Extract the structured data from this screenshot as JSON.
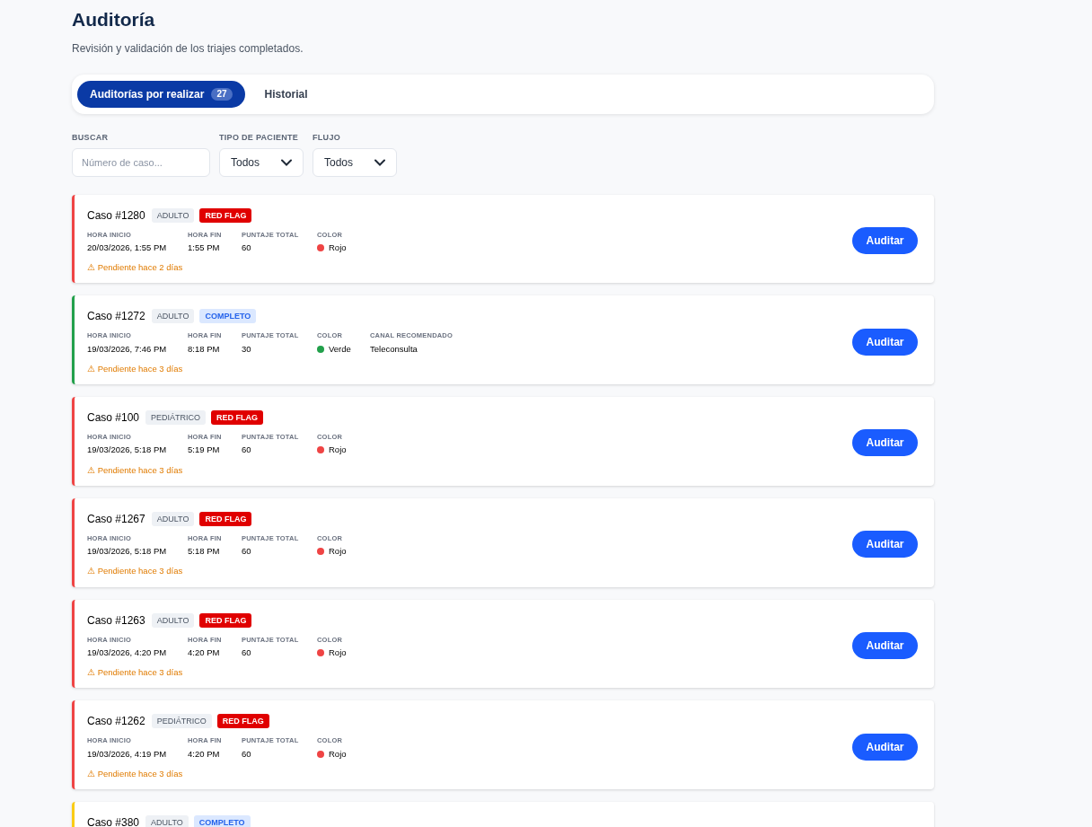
{
  "header": {
    "title": "Auditoría",
    "subtitle": "Revisión y validación de los triajes completados."
  },
  "tabs": [
    {
      "label": "Auditorías por realizar",
      "count": "27",
      "selected": true
    },
    {
      "label": "Historial",
      "selected": false
    }
  ],
  "filters": [
    {
      "kind": "search",
      "label": "BUSCAR",
      "placeholder": "Número de caso..."
    },
    {
      "kind": "select",
      "label": "TIPO DE PACIENTE",
      "value": "Todos"
    },
    {
      "kind": "select",
      "label": "FLUJO",
      "value": "Todos"
    }
  ],
  "cases": [
    {
      "title": "Caso #1280",
      "patient": "ADULTO",
      "status": {
        "kind": "red_flag",
        "label": "RED FLAG"
      },
      "color": "#ef4444",
      "fields": [
        {
          "label": "HORA INICIO",
          "value": "20/03/2026, 1:55 PM"
        },
        {
          "label": "HORA FIN",
          "value": "1:55 PM"
        },
        {
          "label": "PUNTAJE TOTAL",
          "value": "60"
        },
        {
          "kind": "color",
          "label": "COLOR",
          "value": "Rojo",
          "color": "#ef4444"
        }
      ],
      "pending": "⚠ Pendiente hace 2 días",
      "action": "Auditar"
    },
    {
      "title": "Caso #1272",
      "patient": "ADULTO",
      "status": {
        "kind": "complete",
        "label": "COMPLETO"
      },
      "color": "#22a04b",
      "fields": [
        {
          "label": "HORA INICIO",
          "value": "19/03/2026, 7:46 PM"
        },
        {
          "label": "HORA FIN",
          "value": "8:18 PM"
        },
        {
          "label": "PUNTAJE TOTAL",
          "value": "30"
        },
        {
          "kind": "color",
          "label": "COLOR",
          "value": "Verde",
          "color": "#22a04b"
        },
        {
          "label": "CANAL RECOMENDADO",
          "value": "Teleconsulta"
        }
      ],
      "pending": "⚠ Pendiente hace 3 días",
      "action": "Auditar"
    },
    {
      "title": "Caso #100",
      "patient": "PEDIÁTRICO",
      "status": {
        "kind": "red_flag",
        "label": "RED FLAG"
      },
      "color": "#ef4444",
      "fields": [
        {
          "label": "HORA INICIO",
          "value": "19/03/2026, 5:18 PM"
        },
        {
          "label": "HORA FIN",
          "value": "5:19 PM"
        },
        {
          "label": "PUNTAJE TOTAL",
          "value": "60"
        },
        {
          "kind": "color",
          "label": "COLOR",
          "value": "Rojo",
          "color": "#ef4444"
        }
      ],
      "pending": "⚠ Pendiente hace 3 días",
      "action": "Auditar"
    },
    {
      "title": "Caso #1267",
      "patient": "ADULTO",
      "status": {
        "kind": "red_flag",
        "label": "RED FLAG"
      },
      "color": "#ef4444",
      "fields": [
        {
          "label": "HORA INICIO",
          "value": "19/03/2026, 5:18 PM"
        },
        {
          "label": "HORA FIN",
          "value": "5:18 PM"
        },
        {
          "label": "PUNTAJE TOTAL",
          "value": "60"
        },
        {
          "kind": "color",
          "label": "COLOR",
          "value": "Rojo",
          "color": "#ef4444"
        }
      ],
      "pending": "⚠ Pendiente hace 3 días",
      "action": "Auditar"
    },
    {
      "title": "Caso #1263",
      "patient": "ADULTO",
      "status": {
        "kind": "red_flag",
        "label": "RED FLAG"
      },
      "color": "#ef4444",
      "fields": [
        {
          "label": "HORA INICIO",
          "value": "19/03/2026, 4:20 PM"
        },
        {
          "label": "HORA FIN",
          "value": "4:20 PM"
        },
        {
          "label": "PUNTAJE TOTAL",
          "value": "60"
        },
        {
          "kind": "color",
          "label": "COLOR",
          "value": "Rojo",
          "color": "#ef4444"
        }
      ],
      "pending": "⚠ Pendiente hace 3 días",
      "action": "Auditar"
    },
    {
      "title": "Caso #1262",
      "patient": "PEDIÁTRICO",
      "status": {
        "kind": "red_flag",
        "label": "RED FLAG"
      },
      "color": "#ef4444",
      "fields": [
        {
          "label": "HORA INICIO",
          "value": "19/03/2026, 4:19 PM"
        },
        {
          "label": "HORA FIN",
          "value": "4:20 PM"
        },
        {
          "label": "PUNTAJE TOTAL",
          "value": "60"
        },
        {
          "kind": "color",
          "label": "COLOR",
          "value": "Rojo",
          "color": "#ef4444"
        }
      ],
      "pending": "⚠ Pendiente hace 3 días",
      "action": "Auditar"
    },
    {
      "title": "Caso #380",
      "patient": "ADULTO",
      "status": {
        "kind": "complete",
        "label": "COMPLETO"
      },
      "color": "#facc15"
    }
  ]
}
